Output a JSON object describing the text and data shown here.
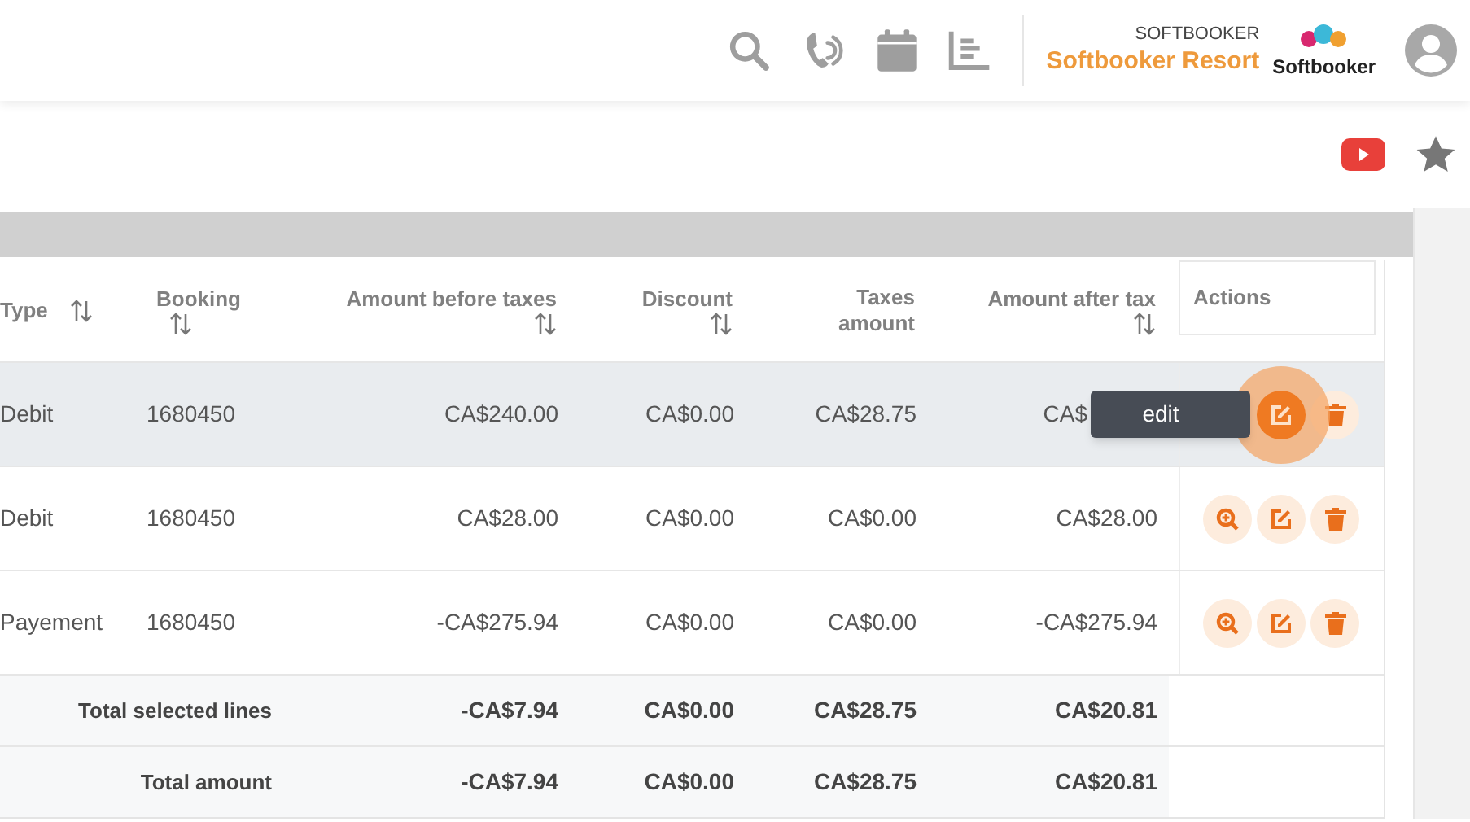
{
  "header": {
    "icons": [
      {
        "kind": "search"
      },
      {
        "kind": "phone"
      },
      {
        "kind": "calendar"
      },
      {
        "kind": "report"
      }
    ],
    "brand": {
      "caption": "SOFTBOOKER",
      "name": "Softbooker Resort",
      "logo_text": "Softbooker"
    }
  },
  "toolbar": {
    "icons": [
      {
        "kind": "video"
      },
      {
        "kind": "favorite"
      }
    ]
  },
  "table": {
    "columns": [
      {
        "label": "Type",
        "sortable": true
      },
      {
        "label": "Booking",
        "sortable": true
      },
      {
        "label": "Amount before taxes",
        "sortable": true
      },
      {
        "label": "Discount",
        "sortable": true
      },
      {
        "label": "Taxes amount",
        "sortable": false
      },
      {
        "label": "Amount after tax",
        "sortable": true
      },
      {
        "label": "Actions",
        "sortable": false
      }
    ],
    "rows": [
      {
        "selected": true,
        "cells": [
          "Debit",
          "1680450",
          "CA$240.00",
          "CA$0.00",
          "CA$28.75",
          "CA$"
        ],
        "actions": [
          {
            "kind": "edit",
            "focused": true
          },
          {
            "kind": "delete",
            "focused": false
          }
        ],
        "tooltip": "edit"
      },
      {
        "selected": false,
        "cells": [
          "Debit",
          "1680450",
          "CA$28.00",
          "CA$0.00",
          "CA$0.00",
          "CA$28.00"
        ],
        "actions": [
          {
            "kind": "view",
            "focused": false
          },
          {
            "kind": "edit",
            "focused": false
          },
          {
            "kind": "delete",
            "focused": false
          }
        ]
      },
      {
        "selected": false,
        "cells": [
          "Payement",
          "1680450",
          "-CA$275.94",
          "CA$0.00",
          "CA$0.00",
          "-CA$275.94"
        ],
        "actions": [
          {
            "kind": "view",
            "focused": false
          },
          {
            "kind": "edit",
            "focused": false
          },
          {
            "kind": "delete",
            "focused": false
          }
        ]
      }
    ],
    "totals": [
      {
        "label": "Total selected lines",
        "values": [
          "-CA$7.94",
          "CA$0.00",
          "CA$28.75",
          "CA$20.81"
        ]
      },
      {
        "label": "Total amount",
        "values": [
          "-CA$7.94",
          "CA$0.00",
          "CA$28.75",
          "CA$20.81"
        ]
      }
    ]
  }
}
